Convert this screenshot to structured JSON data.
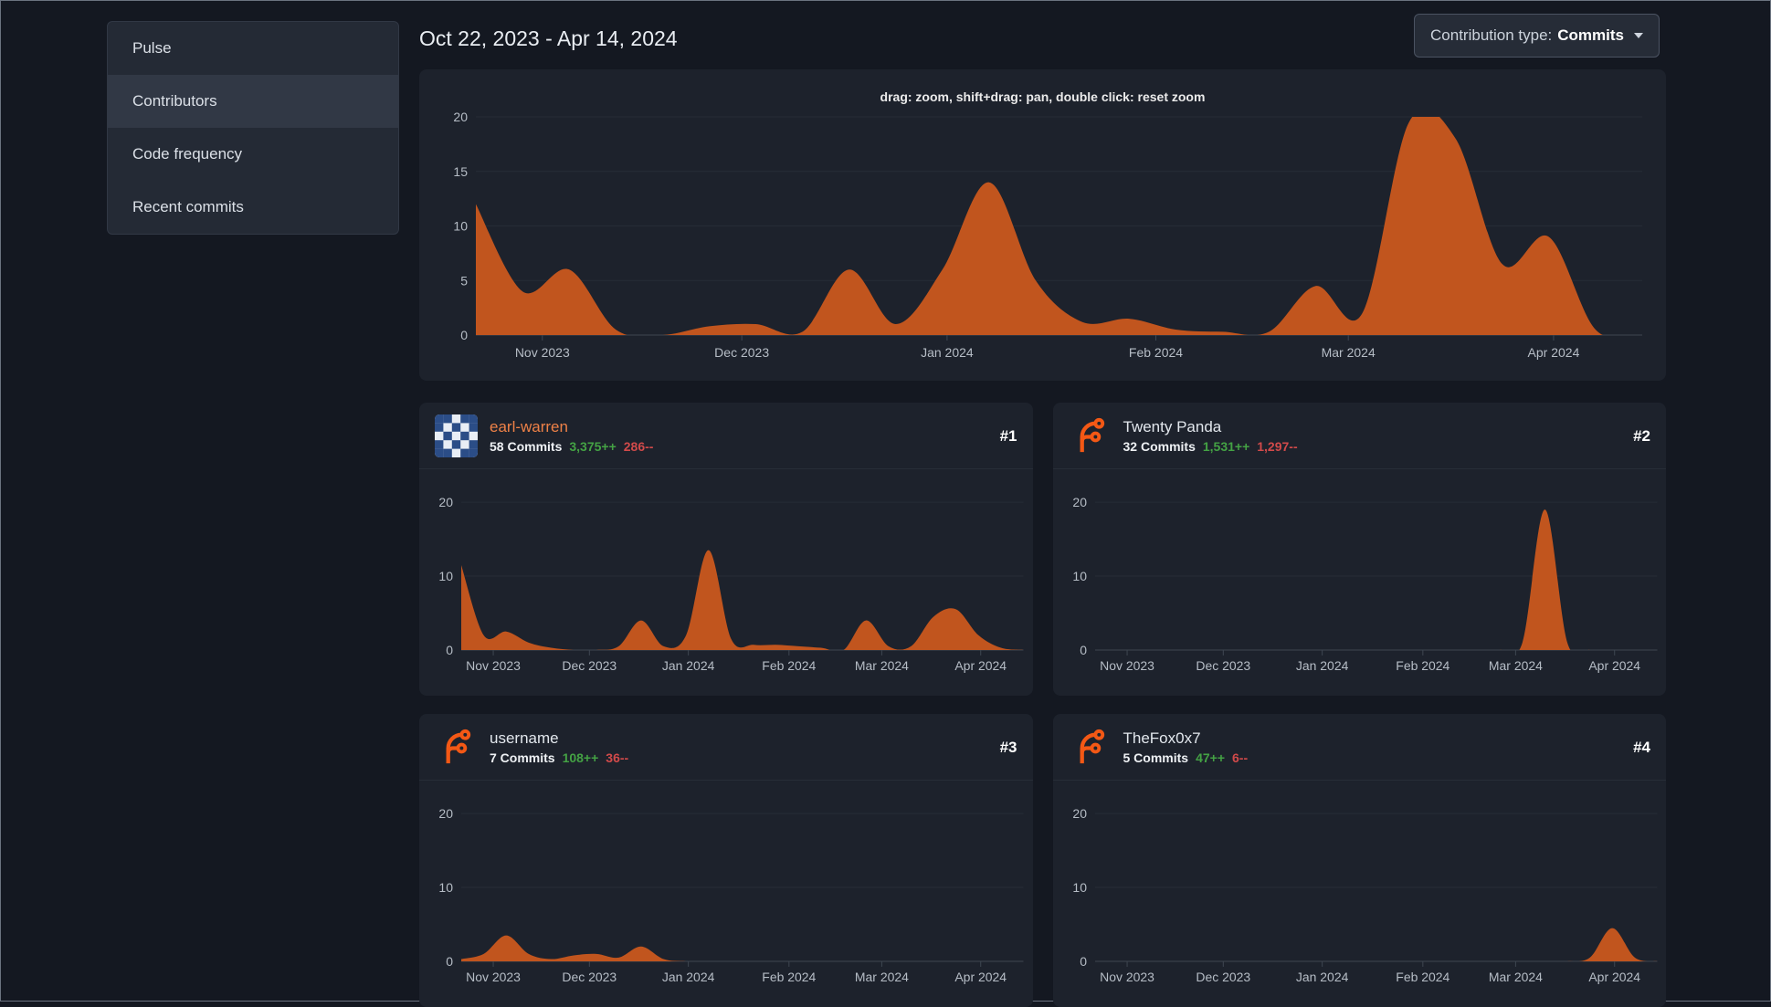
{
  "sidebar": {
    "items": [
      {
        "label": "Pulse",
        "active": false
      },
      {
        "label": "Contributors",
        "active": true
      },
      {
        "label": "Code frequency",
        "active": false
      },
      {
        "label": "Recent commits",
        "active": false
      }
    ]
  },
  "header": {
    "date_range": "Oct 22, 2023 - Apr 14, 2024",
    "contribution_type": {
      "label": "Contribution type:",
      "value": "Commits",
      "icon": "chevron-down"
    }
  },
  "colors": {
    "area": "#c1551e",
    "link_orange": "#ee8147",
    "green": "#44a244",
    "red": "#d14a4a",
    "forgejo_orange": "#f35815",
    "identicon_blue": "#2b4d87",
    "card_bg": "#1d222c",
    "page_bg": "#141821"
  },
  "contributors": [
    {
      "rank": "#1",
      "name": "earl-warren",
      "name_color": "#ee8147",
      "commits": "58 Commits",
      "additions": "3,375++",
      "deletions": "286--",
      "avatar": "identicon"
    },
    {
      "rank": "#2",
      "name": "Twenty Panda",
      "name_color": "#e2e7ed",
      "commits": "32 Commits",
      "additions": "1,531++",
      "deletions": "1,297--",
      "avatar": "forgejo-logo"
    },
    {
      "rank": "#3",
      "name": "username",
      "name_color": "#e2e7ed",
      "commits": "7 Commits",
      "additions": "108++",
      "deletions": "36--",
      "avatar": "forgejo-logo"
    },
    {
      "rank": "#4",
      "name": "TheFox0x7",
      "name_color": "#e2e7ed",
      "commits": "5 Commits",
      "additions": "47++",
      "deletions": "6--",
      "avatar": "forgejo-logo"
    }
  ],
  "chart_data": [
    {
      "type": "area",
      "name": "all-contributors-commits-per-week",
      "subtitle": "drag: zoom, shift+drag: pan, double click: reset zoom",
      "x_range": [
        "Oct 22, 2023",
        "Apr 14, 2024"
      ],
      "interval": "week",
      "x_labels": [
        "Nov 2023",
        "Dec 2023",
        "Jan 2024",
        "Feb 2024",
        "Mar 2024",
        "Apr 2024"
      ],
      "x_positions": [
        0.057,
        0.228,
        0.404,
        0.583,
        0.748,
        0.924
      ],
      "values": [
        12,
        4,
        6,
        0.5,
        0,
        0.8,
        1,
        0.3,
        6,
        1,
        6,
        14,
        5,
        1.2,
        1.5,
        0.5,
        0.3,
        0.3,
        4.5,
        2,
        19.5,
        18,
        6.5,
        9,
        0.5,
        0
      ],
      "ylim": [
        0,
        20
      ],
      "yticks": [
        0,
        5,
        10,
        15,
        20
      ],
      "grid": true,
      "legend": "none"
    },
    {
      "type": "area",
      "name": "earl-warren-commits-per-week",
      "x_labels": [
        "Nov 2023",
        "Dec 2023",
        "Jan 2024",
        "Feb 2024",
        "Mar 2024",
        "Apr 2024"
      ],
      "x_positions": [
        0.057,
        0.228,
        0.404,
        0.583,
        0.748,
        0.924
      ],
      "values": [
        11.5,
        2,
        2.5,
        1,
        0.3,
        0,
        0,
        0.5,
        4,
        0.5,
        2,
        13.5,
        1.5,
        0.7,
        0.7,
        0.5,
        0.3,
        0,
        4,
        0.5,
        0.5,
        4.5,
        5.5,
        2,
        0.3,
        0
      ],
      "ylim": [
        0,
        20
      ],
      "yticks": [
        0,
        10,
        20
      ],
      "grid": true,
      "legend": "none"
    },
    {
      "type": "area",
      "name": "twenty-panda-commits-per-week",
      "x_labels": [
        "Nov 2023",
        "Dec 2023",
        "Jan 2024",
        "Feb 2024",
        "Mar 2024",
        "Apr 2024"
      ],
      "x_positions": [
        0.057,
        0.228,
        0.404,
        0.583,
        0.748,
        0.924
      ],
      "values": [
        0,
        0,
        0,
        0,
        0,
        0,
        0,
        0,
        0,
        0,
        0,
        0,
        0,
        0,
        0,
        0,
        0,
        0,
        0,
        1,
        19,
        1,
        0,
        0,
        0,
        0
      ],
      "ylim": [
        0,
        20
      ],
      "yticks": [
        0,
        10,
        20
      ],
      "grid": true,
      "legend": "none"
    },
    {
      "type": "area",
      "name": "username-commits-per-week",
      "x_labels": [
        "Nov 2023",
        "Dec 2023",
        "Jan 2024",
        "Feb 2024",
        "Mar 2024",
        "Apr 2024"
      ],
      "x_positions": [
        0.057,
        0.228,
        0.404,
        0.583,
        0.748,
        0.924
      ],
      "values": [
        0.3,
        1,
        3.5,
        1,
        0.3,
        0.8,
        1,
        0.5,
        2,
        0.3,
        0,
        0,
        0,
        0,
        0,
        0,
        0,
        0,
        0,
        0,
        0,
        0,
        0,
        0,
        0,
        0
      ],
      "ylim": [
        0,
        20
      ],
      "yticks": [
        0,
        10,
        20
      ],
      "grid": true,
      "legend": "none"
    },
    {
      "type": "area",
      "name": "thefox0x7-commits-per-week",
      "x_labels": [
        "Nov 2023",
        "Dec 2023",
        "Jan 2024",
        "Feb 2024",
        "Mar 2024",
        "Apr 2024"
      ],
      "x_positions": [
        0.057,
        0.228,
        0.404,
        0.583,
        0.748,
        0.924
      ],
      "values": [
        0,
        0,
        0,
        0,
        0,
        0,
        0,
        0,
        0,
        0,
        0,
        0,
        0,
        0,
        0,
        0,
        0,
        0,
        0,
        0,
        0,
        0,
        0.5,
        4.5,
        0.5,
        0
      ],
      "ylim": [
        0,
        20
      ],
      "yticks": [
        0,
        10,
        20
      ],
      "grid": true,
      "legend": "none"
    }
  ]
}
